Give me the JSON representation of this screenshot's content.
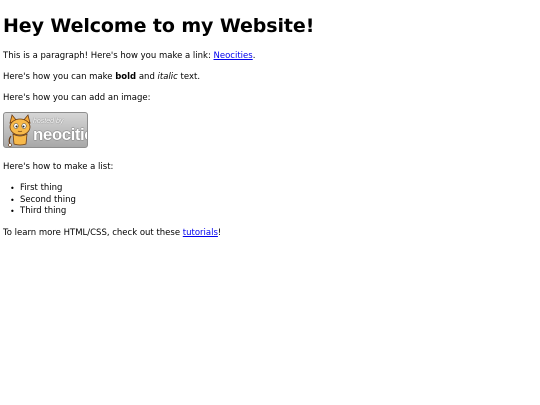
{
  "heading": "Hey Welcome to my Website!",
  "paragraph_link": {
    "before": "This is a paragraph! Here's how you make a link: ",
    "link_text": "Neocities",
    "after": "."
  },
  "paragraph_format": {
    "before": "Here's how you can make ",
    "bold": "bold",
    "middle": " and ",
    "italic": "italic",
    "after": " text."
  },
  "paragraph_image": "Here's how you can add an image:",
  "badge": {
    "hosted_text": "hosted by",
    "brand_text": "neocities",
    "icon": "neocities-cat-icon"
  },
  "paragraph_list": "Here's how to make a list:",
  "list": {
    "bullet": "•",
    "items": [
      "First thing",
      "Second thing",
      "Third thing"
    ]
  },
  "paragraph_tutorial": {
    "before": "To learn more HTML/CSS, check out these ",
    "link_text": "tutorials",
    "after": "!"
  },
  "colors": {
    "link": "#0000ee",
    "text": "#000000",
    "background": "#ffffff"
  }
}
